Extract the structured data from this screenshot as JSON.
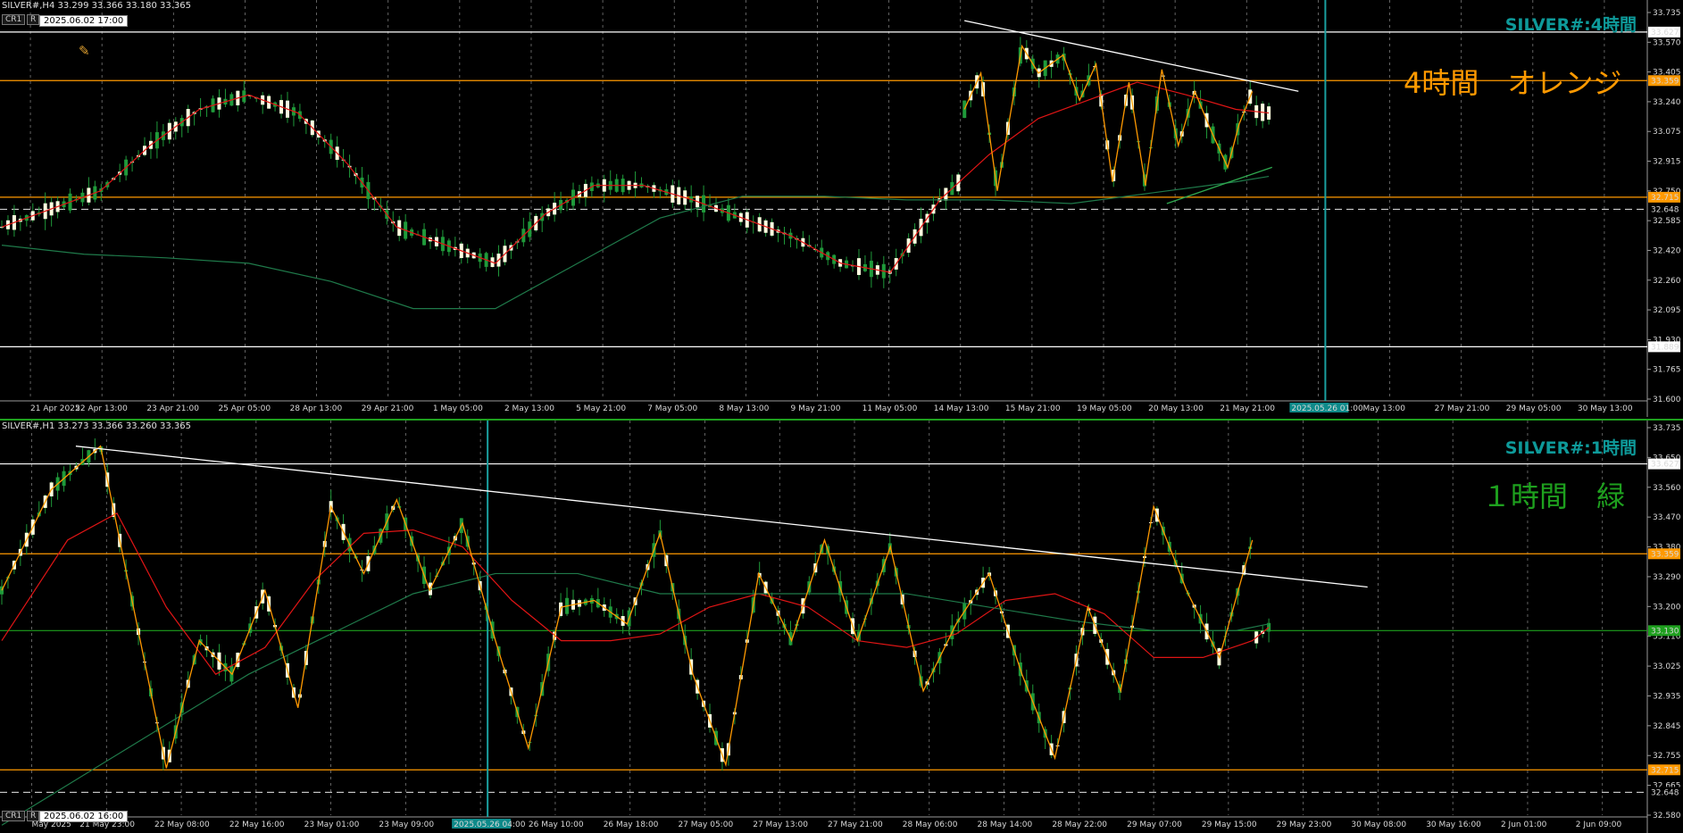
{
  "chart_data": [
    {
      "type": "candlestick",
      "symbol_header": "SILVER#,H4  33.299 33.366 33.180 33.365",
      "title": "SILVER#:4時間",
      "annotation": "4時間　オレンジ",
      "annotation_color": "#ff9900",
      "buttons": [
        "CR1",
        "R"
      ],
      "time_stamp": "2025.06.02 17:00",
      "crosshair_time_label": "2025.05.26 01:00",
      "ylim": [
        31.6,
        33.735
      ],
      "y_ticks": [
        "33.735",
        "33.570",
        "33.405",
        "33.240",
        "33.075",
        "32.915",
        "32.750",
        "32.585",
        "32.420",
        "32.260",
        "32.095",
        "31.930",
        "31.765",
        "31.600"
      ],
      "x_ticks": [
        "21 Apr 2025",
        "22 Apr 13:00",
        "23 Apr 21:00",
        "25 Apr 05:00",
        "28 Apr 13:00",
        "29 Apr 21:00",
        "1 May 05:00",
        "2 May 13:00",
        "5 May 21:00",
        "7 May 05:00",
        "8 May 13:00",
        "9 May 21:00",
        "11 May 05:00",
        "14 May 13:00",
        "15 May 21:00",
        "19 May 05:00",
        "20 May 13:00",
        "21 May 21:00",
        "2025.05.26 01:00",
        "May 13:00",
        "27 May 21:00",
        "29 May 05:00",
        "30 May 13:00"
      ],
      "levels": [
        {
          "price": 33.627,
          "label": "33.627",
          "color": "#ffffff",
          "style": "solid",
          "tag_bg": "#ffffff",
          "tag_fg": "#000000"
        },
        {
          "price": 33.359,
          "label": "33.359",
          "color": "#ff9900",
          "style": "solid",
          "tag_bg": "#ff9900",
          "tag_fg": "#000000"
        },
        {
          "price": 32.715,
          "label": "32.715",
          "color": "#ff9900",
          "style": "solid",
          "tag_bg": "#ff9900",
          "tag_fg": "#000000"
        },
        {
          "price": 32.648,
          "label": "32.648",
          "color": "#cccccc",
          "style": "dash",
          "tag_bg": "#000000",
          "tag_fg": "#ffffff"
        },
        {
          "price": 31.889,
          "label": "31.889",
          "color": "#ffffff",
          "style": "solid",
          "tag_bg": "#ffffff",
          "tag_fg": "#000000"
        }
      ],
      "trendlines": [
        {
          "x1": 0.585,
          "y1": 33.69,
          "x2": 0.788,
          "y2": 33.3,
          "color": "#ffffff"
        },
        {
          "x1": 0.708,
          "y1": 32.68,
          "x2": 0.772,
          "y2": 32.88,
          "color": "#2faa50"
        }
      ],
      "series": [
        {
          "name": "",
          "kind": "ma_fast",
          "color": "#e01515",
          "x": [
            0.0,
            0.03,
            0.06,
            0.09,
            0.12,
            0.15,
            0.18,
            0.21,
            0.24,
            0.27,
            0.3,
            0.33,
            0.36,
            0.39,
            0.42,
            0.45,
            0.48,
            0.51,
            0.54,
            0.57,
            0.6,
            0.63,
            0.66,
            0.69,
            0.72,
            0.75,
            0.77
          ],
          "y": [
            32.55,
            32.65,
            32.75,
            33.0,
            33.2,
            33.28,
            33.18,
            32.9,
            32.55,
            32.45,
            32.35,
            32.62,
            32.78,
            32.78,
            32.7,
            32.6,
            32.5,
            32.35,
            32.3,
            32.7,
            32.95,
            33.15,
            33.25,
            33.35,
            33.28,
            33.2,
            33.18
          ]
        },
        {
          "name": "",
          "kind": "ma_slow",
          "color": "#1f7a4a",
          "x": [
            0.0,
            0.05,
            0.1,
            0.15,
            0.2,
            0.25,
            0.3,
            0.35,
            0.4,
            0.45,
            0.5,
            0.55,
            0.6,
            0.65,
            0.7,
            0.75,
            0.77
          ],
          "y": [
            32.45,
            32.4,
            32.38,
            32.35,
            32.25,
            32.1,
            32.1,
            32.35,
            32.6,
            32.72,
            32.72,
            32.7,
            32.7,
            32.68,
            32.74,
            32.8,
            32.83
          ]
        },
        {
          "name": "",
          "kind": "zigzag",
          "color": "#ff9900",
          "x": [
            0.585,
            0.595,
            0.605,
            0.62,
            0.63,
            0.645,
            0.655,
            0.665,
            0.675,
            0.685,
            0.695,
            0.705,
            0.715,
            0.725,
            0.735,
            0.745,
            0.752,
            0.76
          ],
          "y": [
            33.2,
            33.4,
            32.75,
            33.55,
            33.4,
            33.5,
            33.25,
            33.45,
            32.8,
            33.35,
            32.78,
            33.42,
            33.0,
            33.3,
            33.08,
            32.88,
            33.12,
            33.3
          ]
        }
      ]
    },
    {
      "type": "candlestick",
      "symbol_header": "SILVER#,H1  33.273 33.366 33.260 33.365",
      "title": "SILVER#:1時間",
      "annotation": "１時間　緑",
      "annotation_color": "#1ea01e",
      "buttons": [
        "CR1",
        "R"
      ],
      "time_stamp": "2025.06.02 16:00",
      "crosshair_time_label": "2025.05.26 04:00",
      "ylim": [
        32.58,
        33.735
      ],
      "y_ticks": [
        "33.735",
        "33.650",
        "33.560",
        "33.470",
        "33.380",
        "33.290",
        "33.200",
        "33.110",
        "33.025",
        "32.935",
        "32.845",
        "32.755",
        "32.665",
        "32.580"
      ],
      "x_ticks": [
        "May 2025",
        "21 May 23:00",
        "22 May 08:00",
        "22 May 16:00",
        "23 May 01:00",
        "23 May 09:00",
        "2025.05.26 04:00",
        "26 May 10:00",
        "26 May 18:00",
        "27 May 05:00",
        "27 May 13:00",
        "27 May 21:00",
        "28 May 06:00",
        "28 May 14:00",
        "28 May 22:00",
        "29 May 07:00",
        "29 May 15:00",
        "29 May 23:00",
        "30 May 08:00",
        "30 May 16:00",
        "2 Jun 01:00",
        "2 Jun 09:00"
      ],
      "levels": [
        {
          "price": 33.627,
          "label": "33.627",
          "color": "#ffffff",
          "style": "solid",
          "tag_bg": "#ffffff",
          "tag_fg": "#000000"
        },
        {
          "price": 33.359,
          "label": "33.359",
          "color": "#ff9900",
          "style": "solid",
          "tag_bg": "#ff9900",
          "tag_fg": "#000000"
        },
        {
          "price": 33.13,
          "label": "33.130",
          "color": "#1ea01e",
          "style": "solid",
          "tag_bg": "#1ea01e",
          "tag_fg": "#000000"
        },
        {
          "price": 32.715,
          "label": "32.715",
          "color": "#ff9900",
          "style": "solid",
          "tag_bg": "#ff9900",
          "tag_fg": "#000000"
        },
        {
          "price": 32.648,
          "label": "32.648",
          "color": "#cccccc",
          "style": "dash",
          "tag_bg": "#000000",
          "tag_fg": "#ffffff"
        }
      ],
      "trendlines": [
        {
          "x1": 0.045,
          "y1": 33.68,
          "x2": 0.83,
          "y2": 33.26,
          "color": "#ffffff"
        }
      ],
      "series": [
        {
          "name": "",
          "kind": "ma_fast",
          "color": "#e01515",
          "x": [
            0.0,
            0.04,
            0.07,
            0.1,
            0.13,
            0.16,
            0.19,
            0.22,
            0.25,
            0.28,
            0.31,
            0.34,
            0.37,
            0.4,
            0.43,
            0.46,
            0.49,
            0.52,
            0.55,
            0.58,
            0.61,
            0.64,
            0.67,
            0.7,
            0.73,
            0.76,
            0.77
          ],
          "y": [
            33.1,
            33.4,
            33.48,
            33.2,
            33.0,
            33.08,
            33.28,
            33.42,
            33.43,
            33.38,
            33.22,
            33.1,
            33.1,
            33.12,
            33.2,
            33.24,
            33.2,
            33.1,
            33.08,
            33.12,
            33.22,
            33.24,
            33.18,
            33.05,
            33.05,
            33.1,
            33.14
          ]
        },
        {
          "name": "",
          "kind": "ma_slow",
          "color": "#1f7a4a",
          "x": [
            0.0,
            0.05,
            0.1,
            0.15,
            0.2,
            0.25,
            0.3,
            0.35,
            0.4,
            0.45,
            0.5,
            0.55,
            0.6,
            0.65,
            0.7,
            0.75,
            0.77
          ],
          "y": [
            32.55,
            32.7,
            32.85,
            33.0,
            33.12,
            33.24,
            33.3,
            33.3,
            33.24,
            33.24,
            33.24,
            33.24,
            33.2,
            33.16,
            33.13,
            33.13,
            33.15
          ]
        },
        {
          "name": "",
          "kind": "zigzag",
          "color": "#ff9900",
          "x": [
            0.0,
            0.03,
            0.06,
            0.08,
            0.1,
            0.12,
            0.14,
            0.16,
            0.18,
            0.2,
            0.22,
            0.24,
            0.26,
            0.28,
            0.3,
            0.32,
            0.34,
            0.36,
            0.38,
            0.4,
            0.42,
            0.44,
            0.46,
            0.48,
            0.5,
            0.52,
            0.54,
            0.56,
            0.58,
            0.6,
            0.62,
            0.64,
            0.66,
            0.68,
            0.7,
            0.72,
            0.74,
            0.76
          ],
          "y": [
            33.25,
            33.55,
            33.68,
            33.2,
            32.72,
            33.1,
            33.0,
            33.25,
            32.9,
            33.5,
            33.3,
            33.52,
            33.25,
            33.45,
            33.1,
            32.78,
            33.2,
            33.22,
            33.15,
            33.42,
            33.0,
            32.73,
            33.3,
            33.1,
            33.4,
            33.1,
            33.38,
            32.95,
            33.15,
            33.3,
            33.0,
            32.75,
            33.2,
            32.95,
            33.5,
            33.25,
            33.05,
            33.4
          ]
        }
      ]
    }
  ]
}
